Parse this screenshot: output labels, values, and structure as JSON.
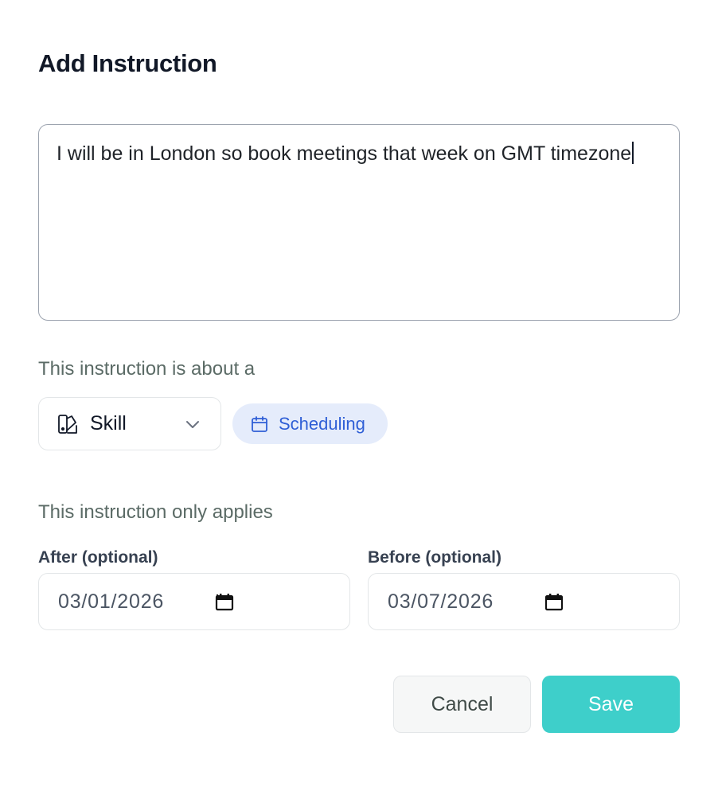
{
  "dialog": {
    "title": "Add Instruction"
  },
  "instruction": {
    "text": "I will be in London so book meetings that week on GMT timezone"
  },
  "about": {
    "label": "This instruction is about a",
    "type_select_value": "Skill",
    "type_icon": "skill-icon",
    "skill_chip": {
      "label": "Scheduling",
      "icon": "calendar-icon",
      "color": "#2f5fd6",
      "background": "#e5ecfb"
    }
  },
  "applies": {
    "label": "This instruction only applies",
    "after": {
      "label": "After (optional)",
      "value": "03/01/2026"
    },
    "before": {
      "label": "Before (optional)",
      "value": "03/07/2026"
    }
  },
  "actions": {
    "cancel_label": "Cancel",
    "save_label": "Save",
    "save_color": "#3ecfca"
  }
}
